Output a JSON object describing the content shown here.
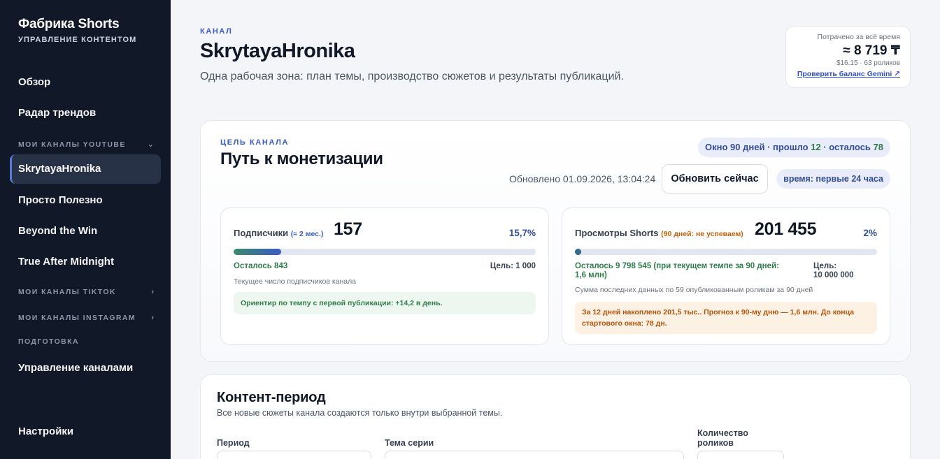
{
  "sidebar": {
    "brand_title": "Фабрика Shorts",
    "brand_subtitle": "УПРАВЛЕНИЕ КОНТЕНТОМ",
    "nav": {
      "overview": "Обзор",
      "trends": "Радар трендов"
    },
    "section_youtube": "МОИ КАНАЛЫ YOUTUBE",
    "youtube_channels": [
      "SkrytayaHronika",
      "Просто Полезно",
      "Beyond the Win",
      "True After Midnight"
    ],
    "active_channel": "SkrytayaHronika",
    "section_tiktok": "МОИ КАНАЛЫ TIKTOK",
    "section_instagram": "МОИ КАНАЛЫ INSTAGRAM",
    "section_prep": "ПОДГОТОВКА",
    "manage_channels": "Управление каналами",
    "settings": "Настройки"
  },
  "header": {
    "eyebrow": "КАНАЛ",
    "title": "SkrytayaHronika",
    "description": "Одна рабочая зона: план темы, производство сюжетов и результаты публикаций."
  },
  "spend": {
    "label": "Потрачено за всё время",
    "value": "≈ 8 719 ₸",
    "meta": "$16.15 · 63 роликов",
    "link": "Проверить баланс Gemini ↗"
  },
  "goal": {
    "eyebrow": "ЦЕЛЬ КАНАЛА",
    "title": "Путь к монетизации",
    "window_prefix": "Окно 90 дней · прошло ",
    "window_elapsed": "12",
    "window_middle": " · осталось ",
    "window_left": "78",
    "updated": "Обновлено 01.09.2026, 13:04:24",
    "refresh_button": "Обновить сейчас",
    "time_pill": "время: первые 24 часа",
    "subscribers": {
      "label": "Подписчики",
      "note": "(≈ 2 мес.)",
      "value": "157",
      "percent": "15,7%",
      "progress": 0.157,
      "remaining": "Осталось 843",
      "goal": "Цель: 1 000",
      "caption": "Текущее число подписчиков канала",
      "hint": "Ориентир по темпу с первой публикации: +14,2 в день."
    },
    "views": {
      "label": "Просмотры Shorts",
      "note": "(90 дней: не успеваем)",
      "value": "201 455",
      "percent": "2%",
      "progress": 0.02,
      "remaining_line1": "Осталось 9 798 545 (при текущем темпе за 90 дней:",
      "remaining_line2": "1,6 млн)",
      "goal_line1": "Цель:",
      "goal_line2": "10 000 000",
      "caption": "Сумма последних данных по 59 опубликованным роликам за 90 дней",
      "hint_line1": "За 12 дней накоплено 201,5 тыс.. Прогноз к 90-му дню — 1,6 млн. До конца",
      "hint_line2": "стартового окна: 78 дн."
    }
  },
  "content_period": {
    "title": "Контент-период",
    "description": "Все новые сюжеты канала создаются только внутри выбранной темы.",
    "period_label": "Период",
    "theme_label": "Тема серии",
    "count_label_line1": "Количество",
    "count_label_line2": "роликов"
  },
  "colors": {
    "sidebar_bg": "#111827",
    "accent_blue": "#3b5bc6",
    "success_green": "#2f7d4a",
    "warning_orange": "#c2610c"
  }
}
